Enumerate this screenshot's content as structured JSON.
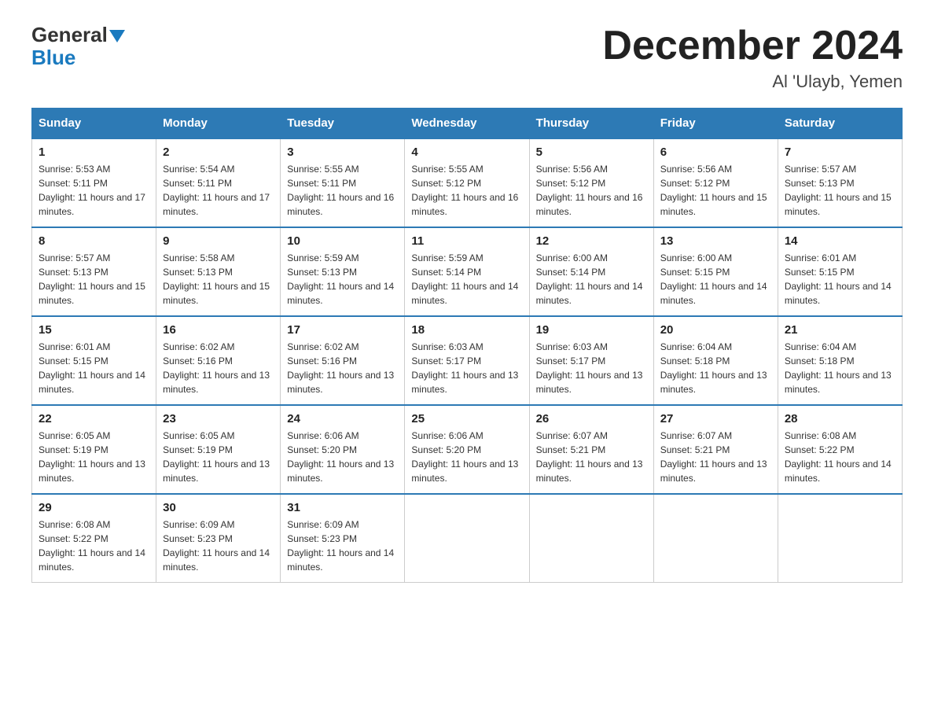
{
  "header": {
    "logo_general": "General",
    "logo_blue": "Blue",
    "month_title": "December 2024",
    "location": "Al 'Ulayb, Yemen"
  },
  "days_of_week": [
    "Sunday",
    "Monday",
    "Tuesday",
    "Wednesday",
    "Thursday",
    "Friday",
    "Saturday"
  ],
  "weeks": [
    [
      {
        "day": "1",
        "sunrise": "5:53 AM",
        "sunset": "5:11 PM",
        "daylight": "11 hours and 17 minutes."
      },
      {
        "day": "2",
        "sunrise": "5:54 AM",
        "sunset": "5:11 PM",
        "daylight": "11 hours and 17 minutes."
      },
      {
        "day": "3",
        "sunrise": "5:55 AM",
        "sunset": "5:11 PM",
        "daylight": "11 hours and 16 minutes."
      },
      {
        "day": "4",
        "sunrise": "5:55 AM",
        "sunset": "5:12 PM",
        "daylight": "11 hours and 16 minutes."
      },
      {
        "day": "5",
        "sunrise": "5:56 AM",
        "sunset": "5:12 PM",
        "daylight": "11 hours and 16 minutes."
      },
      {
        "day": "6",
        "sunrise": "5:56 AM",
        "sunset": "5:12 PM",
        "daylight": "11 hours and 15 minutes."
      },
      {
        "day": "7",
        "sunrise": "5:57 AM",
        "sunset": "5:13 PM",
        "daylight": "11 hours and 15 minutes."
      }
    ],
    [
      {
        "day": "8",
        "sunrise": "5:57 AM",
        "sunset": "5:13 PM",
        "daylight": "11 hours and 15 minutes."
      },
      {
        "day": "9",
        "sunrise": "5:58 AM",
        "sunset": "5:13 PM",
        "daylight": "11 hours and 15 minutes."
      },
      {
        "day": "10",
        "sunrise": "5:59 AM",
        "sunset": "5:13 PM",
        "daylight": "11 hours and 14 minutes."
      },
      {
        "day": "11",
        "sunrise": "5:59 AM",
        "sunset": "5:14 PM",
        "daylight": "11 hours and 14 minutes."
      },
      {
        "day": "12",
        "sunrise": "6:00 AM",
        "sunset": "5:14 PM",
        "daylight": "11 hours and 14 minutes."
      },
      {
        "day": "13",
        "sunrise": "6:00 AM",
        "sunset": "5:15 PM",
        "daylight": "11 hours and 14 minutes."
      },
      {
        "day": "14",
        "sunrise": "6:01 AM",
        "sunset": "5:15 PM",
        "daylight": "11 hours and 14 minutes."
      }
    ],
    [
      {
        "day": "15",
        "sunrise": "6:01 AM",
        "sunset": "5:15 PM",
        "daylight": "11 hours and 14 minutes."
      },
      {
        "day": "16",
        "sunrise": "6:02 AM",
        "sunset": "5:16 PM",
        "daylight": "11 hours and 13 minutes."
      },
      {
        "day": "17",
        "sunrise": "6:02 AM",
        "sunset": "5:16 PM",
        "daylight": "11 hours and 13 minutes."
      },
      {
        "day": "18",
        "sunrise": "6:03 AM",
        "sunset": "5:17 PM",
        "daylight": "11 hours and 13 minutes."
      },
      {
        "day": "19",
        "sunrise": "6:03 AM",
        "sunset": "5:17 PM",
        "daylight": "11 hours and 13 minutes."
      },
      {
        "day": "20",
        "sunrise": "6:04 AM",
        "sunset": "5:18 PM",
        "daylight": "11 hours and 13 minutes."
      },
      {
        "day": "21",
        "sunrise": "6:04 AM",
        "sunset": "5:18 PM",
        "daylight": "11 hours and 13 minutes."
      }
    ],
    [
      {
        "day": "22",
        "sunrise": "6:05 AM",
        "sunset": "5:19 PM",
        "daylight": "11 hours and 13 minutes."
      },
      {
        "day": "23",
        "sunrise": "6:05 AM",
        "sunset": "5:19 PM",
        "daylight": "11 hours and 13 minutes."
      },
      {
        "day": "24",
        "sunrise": "6:06 AM",
        "sunset": "5:20 PM",
        "daylight": "11 hours and 13 minutes."
      },
      {
        "day": "25",
        "sunrise": "6:06 AM",
        "sunset": "5:20 PM",
        "daylight": "11 hours and 13 minutes."
      },
      {
        "day": "26",
        "sunrise": "6:07 AM",
        "sunset": "5:21 PM",
        "daylight": "11 hours and 13 minutes."
      },
      {
        "day": "27",
        "sunrise": "6:07 AM",
        "sunset": "5:21 PM",
        "daylight": "11 hours and 13 minutes."
      },
      {
        "day": "28",
        "sunrise": "6:08 AM",
        "sunset": "5:22 PM",
        "daylight": "11 hours and 14 minutes."
      }
    ],
    [
      {
        "day": "29",
        "sunrise": "6:08 AM",
        "sunset": "5:22 PM",
        "daylight": "11 hours and 14 minutes."
      },
      {
        "day": "30",
        "sunrise": "6:09 AM",
        "sunset": "5:23 PM",
        "daylight": "11 hours and 14 minutes."
      },
      {
        "day": "31",
        "sunrise": "6:09 AM",
        "sunset": "5:23 PM",
        "daylight": "11 hours and 14 minutes."
      },
      null,
      null,
      null,
      null
    ]
  ],
  "sunrise_label": "Sunrise:",
  "sunset_label": "Sunset:",
  "daylight_label": "Daylight:"
}
